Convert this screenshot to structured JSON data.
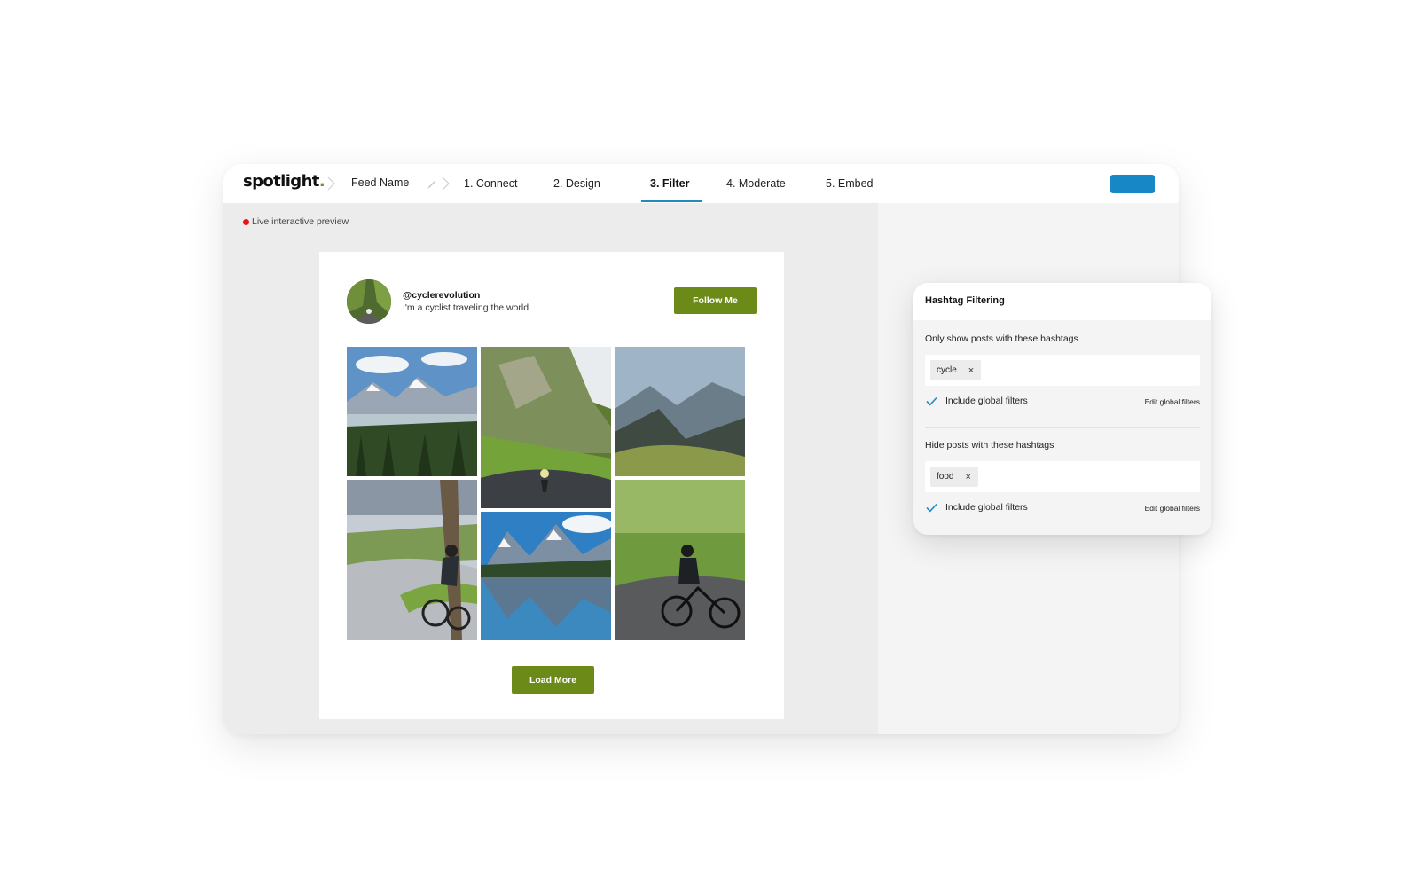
{
  "header": {
    "logo": "spotlight",
    "logo_dot": ".",
    "feed_name": "Feed Name",
    "steps": [
      "1. Connect",
      "2. Design",
      "3. Filter",
      "4. Moderate",
      "5. Embed"
    ],
    "active_step": "3. Filter",
    "accent_color": "#1787c5"
  },
  "preview": {
    "live_label": "Live interactive preview",
    "live_color": "#e8141d",
    "profile": {
      "handle": "@cyclerevolution",
      "bio": "I'm a cyclist traveling the world"
    },
    "follow_label": "Follow Me",
    "load_more_label": "Load More",
    "button_color": "#6b8a17",
    "photos": [
      "mountain-lake-photo",
      "cliff-road-cyclist-photo",
      "mountain-valley-photo",
      "cyclist-curve-photo",
      "lake-reflection-photo",
      "cyclist-motion-photo"
    ]
  },
  "hashtag_panel": {
    "title": "Hashtag Filtering",
    "include_section": {
      "label": "Only show posts with these hashtags",
      "tags": [
        "cycle"
      ],
      "checkbox_label": "Include global filters",
      "checked": true,
      "edit_link": "Edit global filters"
    },
    "exclude_section": {
      "label": "Hide posts with these hashtags",
      "tags": [
        "food"
      ],
      "checkbox_label": "Include global filters",
      "checked": true,
      "edit_link": "Edit global filters"
    },
    "chip_remove_glyph": "×"
  }
}
